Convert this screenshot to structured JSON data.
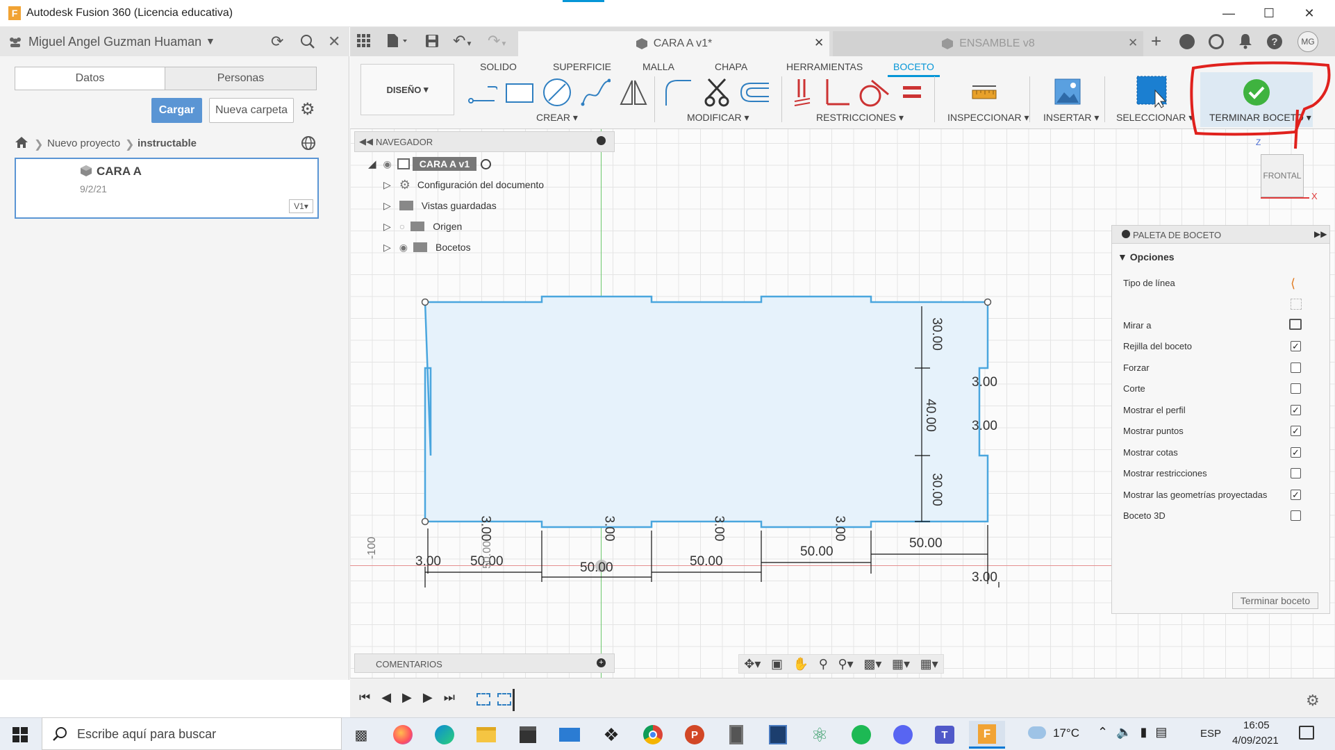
{
  "titlebar": {
    "title": "Autodesk Fusion 360 (Licencia educativa)",
    "app_icon": "F"
  },
  "left_panel": {
    "user": "Miguel Angel Guzman Huaman",
    "tabs": [
      "Datos",
      "Personas"
    ],
    "upload_button": "Cargar",
    "new_folder_button": "Nueva carpeta",
    "breadcrumb": [
      "Nuevo proyecto",
      "instructable"
    ],
    "file_card": {
      "name": "CARA A",
      "date": "9/2/21",
      "version": "V1"
    }
  },
  "doc_tabs": [
    {
      "label": "CARA A v1*",
      "active": true
    },
    {
      "label": "ENSAMBLE v8",
      "active": false
    }
  ],
  "user_initials": "MG",
  "ribbon": {
    "workspace": "DISEÑO",
    "tabs": [
      "SOLIDO",
      "SUPERFICIE",
      "MALLA",
      "CHAPA",
      "HERRAMIENTAS",
      "BOCETO"
    ],
    "active_tab": "BOCETO",
    "groups": [
      "CREAR",
      "MODIFICAR",
      "RESTRICCIONES",
      "INSPECCIONAR",
      "INSERTAR",
      "SELECCIONAR",
      "TERMINAR BOCETO"
    ]
  },
  "navigator": {
    "title": "NAVEGADOR",
    "root": "CARA A v1",
    "items": [
      "Configuración del documento",
      "Vistas guardadas",
      "Origen",
      "Bocetos"
    ]
  },
  "comments_label": "COMENTARIOS",
  "viewcube": {
    "face": "FRONTAL",
    "axis_x": "X",
    "axis_z": "Z"
  },
  "palette": {
    "title": "PALETA DE BOCETO",
    "section": "Opciones",
    "options": [
      {
        "label": "Tipo de línea",
        "type": "icon"
      },
      {
        "label": "Mirar a",
        "type": "icon"
      },
      {
        "label": "Rejilla del boceto",
        "checked": true
      },
      {
        "label": "Forzar",
        "checked": false
      },
      {
        "label": "Corte",
        "checked": false
      },
      {
        "label": "Mostrar el perfil",
        "checked": true
      },
      {
        "label": "Mostrar puntos",
        "checked": true
      },
      {
        "label": "Mostrar cotas",
        "checked": true
      },
      {
        "label": "Mostrar restricciones",
        "checked": false
      },
      {
        "label": "Mostrar las geometrías proyectadas",
        "checked": true
      },
      {
        "label": "Boceto 3D",
        "checked": false
      }
    ],
    "finish_button": "Terminar boceto"
  },
  "sketch": {
    "dimensions": [
      "30.00",
      "40.00",
      "30.00",
      "3.00",
      "3.00",
      "3.00",
      "50.00",
      "50.00",
      "50.00",
      "50.00",
      "3.00",
      "3.00",
      "3.00",
      "3.00",
      "50.00",
      "3.00",
      "50.00",
      "-100",
      "3.00"
    ],
    "axis_label": "-100"
  },
  "taskbar": {
    "search_placeholder": "Escribe aquí para buscar",
    "weather": "17°C",
    "language": "ESP",
    "time": "16:05",
    "date": "4/09/2021"
  },
  "colors": {
    "accent": "#0696d7",
    "sketch_fill": "#e6f2fb",
    "sketch_line": "#4aa6de",
    "annotation_red": "#e0211d"
  }
}
